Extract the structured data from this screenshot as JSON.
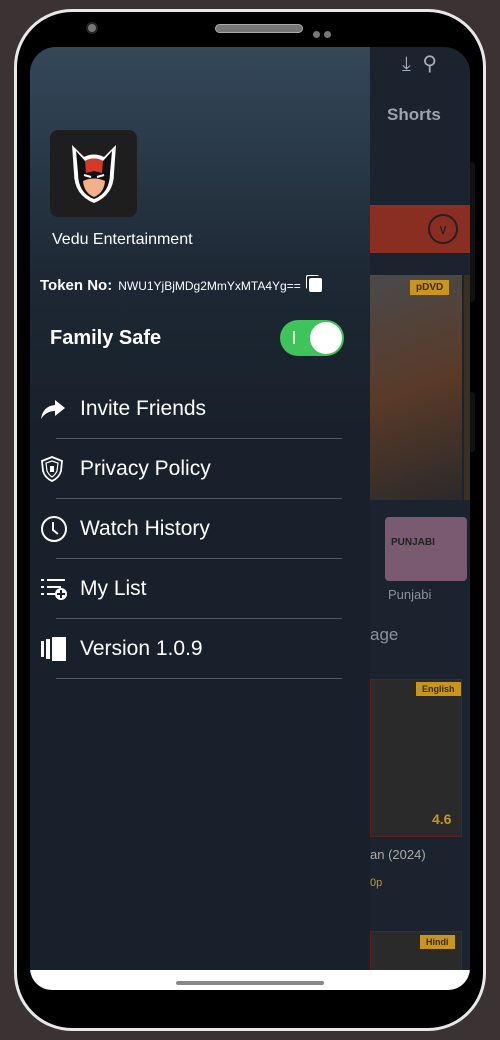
{
  "drawer": {
    "app_name": "Vedu Entertainment",
    "token_label": "Token No:",
    "token_value": "NWU1YjBjMDg2MmYxMTA4Yg==",
    "family_safe_label": "Family Safe",
    "family_safe_on": true,
    "items": [
      {
        "label": "Invite Friends",
        "icon": "share-arrow-icon"
      },
      {
        "label": "Privacy Policy",
        "icon": "shield-icon"
      },
      {
        "label": "Watch History",
        "icon": "clock-icon"
      },
      {
        "label": "My List",
        "icon": "playlist-add-icon"
      },
      {
        "label": "Version 1.0.9",
        "icon": "version-icon"
      }
    ]
  },
  "background": {
    "tab": "Shorts",
    "badges": [
      "pDVD",
      "English",
      "Hindi"
    ],
    "category": "Punjabi",
    "category_thumb_text": "PUNJABI",
    "section_fragment": "age",
    "title_fragment": "an (2024)",
    "quality_fragment": "0p",
    "rating": "4.6"
  },
  "colors": {
    "toggle_on": "#3ec45a",
    "accent": "#c8961e"
  }
}
